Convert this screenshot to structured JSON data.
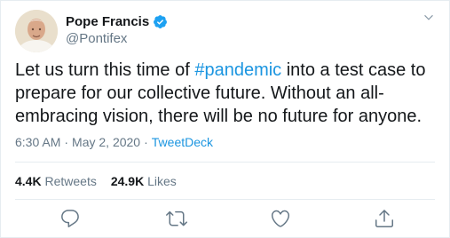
{
  "author": {
    "display_name": "Pope Francis",
    "handle": "@Pontifex",
    "verified": true,
    "avatar_icon": "avatar-portrait"
  },
  "tweet": {
    "text_before": "Let us turn this time of ",
    "hashtag": "#pandemic",
    "text_after": " into a test case to prepare for our collective future. Without an all-embracing vision, there will be no future for anyone."
  },
  "meta": {
    "time": "6:30 AM",
    "separator": "·",
    "date": "May 2, 2020",
    "source": "TweetDeck"
  },
  "stats": {
    "retweets_count": "4.4K",
    "retweets_label": "Retweets",
    "likes_count": "24.9K",
    "likes_label": "Likes"
  },
  "actions": [
    "reply-icon",
    "retweet-icon",
    "like-icon",
    "share-icon"
  ],
  "colors": {
    "link": "#1b95e0",
    "secondary_text": "#657786",
    "primary_text": "#14171a",
    "border": "#e6ecf0",
    "verified": "#1da1f2"
  }
}
